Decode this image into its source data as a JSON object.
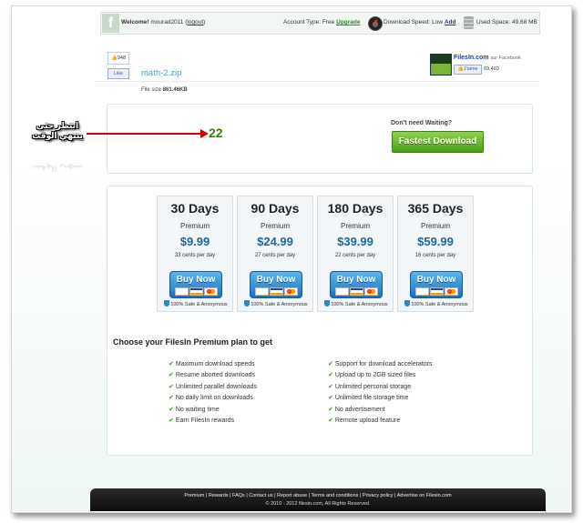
{
  "topbar": {
    "welcome": "Welcome!",
    "username": "mourad2011",
    "logout": "logout",
    "account_type_label": "Account Type: Free",
    "upgrade": "Upgrade",
    "download_speed_label": "Download Speed: Low",
    "add": "Add",
    "used_space": "Used Space: 49.68 MB"
  },
  "file": {
    "like_count": "948",
    "fb_like": "Like",
    "name": "math-2.zip",
    "size_label": "File size",
    "size_value": "861.46KB"
  },
  "facebook_panel": {
    "title": "FilesIn.com",
    "subtitle": "sur Facebook",
    "jaime": "J'aime",
    "likes": "69,403"
  },
  "wait": {
    "countdown": "22",
    "annotation_line1": "انتظر حتى",
    "annotation_line2": "ينتهي الوقت",
    "dont_wait": "Don't need Waiting?",
    "fastest_download": "Fastest Download"
  },
  "plans": [
    {
      "days": "30 Days",
      "tier": "Premium",
      "price": "$9.99",
      "cents": "33 cents per day",
      "buy": "Buy Now",
      "safe": "100% Safe & Anonymous"
    },
    {
      "days": "90 Days",
      "tier": "Premium",
      "price": "$24.99",
      "cents": "27 cents per day",
      "buy": "Buy Now",
      "safe": "100% Safe & Anonymous"
    },
    {
      "days": "180 Days",
      "tier": "Premium",
      "price": "$39.99",
      "cents": "22 cents per day",
      "buy": "Buy Now",
      "safe": "100% Safe & Anonymous"
    },
    {
      "days": "365 Days",
      "tier": "Premium",
      "price": "$59.99",
      "cents": "16 cents per day",
      "buy": "Buy Now",
      "safe": "100% Safe & Anonymous"
    }
  ],
  "features": {
    "title": "Choose your FilesIn Premium plan to get",
    "left": [
      "Maximum download speeds",
      "Resume aborted downloads",
      "Unlimited parallel downloads",
      "No daily limit on downloads",
      "No waiting time",
      "Earn FilesIn rewards"
    ],
    "right": [
      "Support for download accelerators",
      "Upload up to 2GB sized files",
      "Unlimited personal storage",
      "Unlimited file storage time",
      "No advertisement",
      "Remote upload feature"
    ]
  },
  "footer": {
    "links": "Premium | Rewards | FAQs | Contact us | Report abuse | Terms and conditions | Privacy policy | Advertise on Filesin.com",
    "copyright": "© 2010 - 2012 filesin.com, All Rights Reserved."
  },
  "colors": {
    "accent_green": "#4e9d17",
    "price_blue": "#1a6aa0",
    "arrow_red": "#d40000"
  }
}
